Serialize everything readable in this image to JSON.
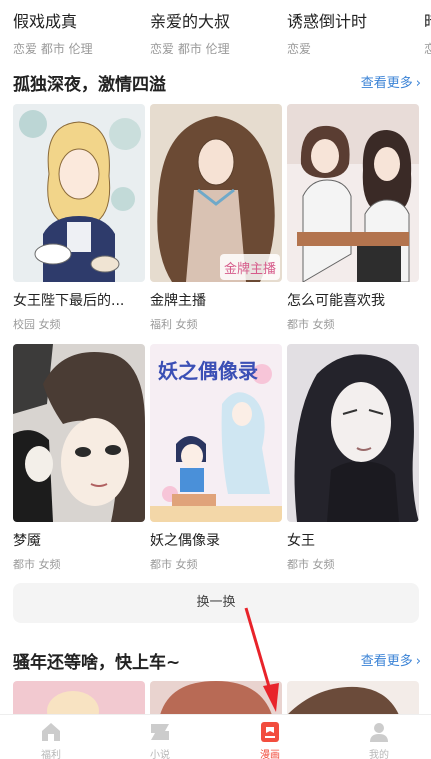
{
  "top_row": [
    {
      "title": "假戏成真",
      "tags": "恋爱 都市 伦理"
    },
    {
      "title": "亲爱的大叔",
      "tags": "恋爱 都市 伦理"
    },
    {
      "title": "诱惑倒计时",
      "tags": "恋爱"
    },
    {
      "title": "暗",
      "tags": "恋"
    }
  ],
  "section1": {
    "title": "孤独深夜，激情四溢",
    "more_label": "查看更多",
    "cards": [
      {
        "title": "女王陛下最后的...",
        "tags": "校园 女频"
      },
      {
        "title": "金牌主播",
        "tags": "福利 女频"
      },
      {
        "title": "怎么可能喜欢我",
        "tags": "都市 女频"
      },
      {
        "title": "梦魇",
        "tags": "都市 女频"
      },
      {
        "title": "妖之偶像录",
        "tags": "都市 女频"
      },
      {
        "title": "女王",
        "tags": "都市 女频"
      }
    ],
    "cover_text": {
      "card2": "金牌主播",
      "card5": "妖之偶像录"
    }
  },
  "swap_label": "换一换",
  "section2": {
    "title": "骚年还等啥，快上车~",
    "more_label": "查看更多"
  },
  "tabs": [
    {
      "label": "福利",
      "icon": "home-icon",
      "active": false
    },
    {
      "label": "小说",
      "icon": "book-icon",
      "active": false
    },
    {
      "label": "漫画",
      "icon": "comic-icon",
      "active": true
    },
    {
      "label": "我的",
      "icon": "profile-icon",
      "active": false
    }
  ],
  "colors": {
    "accent_blue": "#3b83d6",
    "active_red": "#f24d3e",
    "annotation_arrow": "#e8232a"
  }
}
